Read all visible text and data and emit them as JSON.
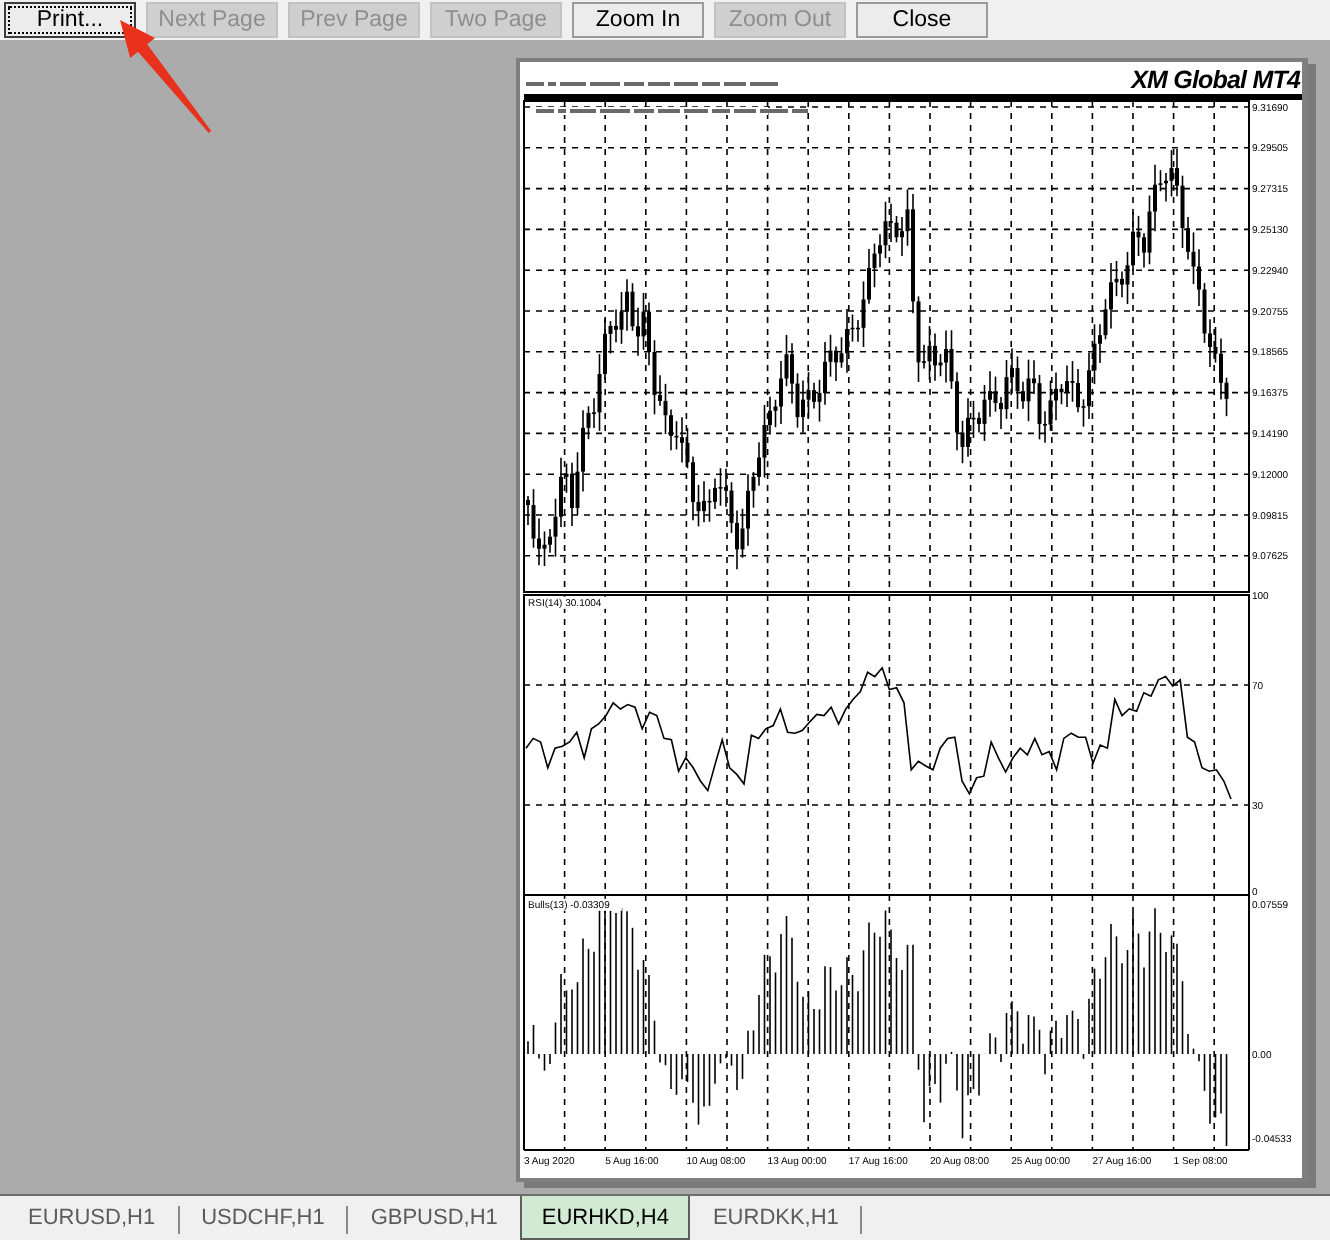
{
  "toolbar": {
    "buttons": [
      {
        "label": "Print...",
        "disabled": false,
        "focused": true
      },
      {
        "label": "Next Page",
        "disabled": true,
        "focused": false
      },
      {
        "label": "Prev Page",
        "disabled": true,
        "focused": false
      },
      {
        "label": "Two Page",
        "disabled": true,
        "focused": false
      },
      {
        "label": "Zoom In",
        "disabled": false,
        "focused": false
      },
      {
        "label": "Zoom Out",
        "disabled": true,
        "focused": false
      },
      {
        "label": "Close",
        "disabled": false,
        "focused": false
      }
    ]
  },
  "print_page": {
    "title": "XM Global MT4",
    "price_axis": [
      "9.31690",
      "9.29505",
      "9.27315",
      "9.25130",
      "9.22940",
      "9.20755",
      "9.18565",
      "9.16375",
      "9.14190",
      "9.12000",
      "9.09815",
      "9.07625"
    ],
    "rsi_panel": {
      "chart_data": {
        "type": "line",
        "title": "RSI(14) 30.1004",
        "ylim": [
          0,
          100
        ],
        "yticks": [
          100,
          70,
          30,
          0
        ],
        "grid": true,
        "series": [
          {
            "color": "#000000",
            "values": [
              48.9,
              52.2,
              51,
              42.4,
              48.9,
              49.6,
              51,
              54.3,
              45.7,
              55.4,
              57,
              59.8,
              64.1,
              62,
              63.5,
              62.6,
              55.4,
              60.9,
              59.8,
              52.2,
              51.7,
              41.3,
              45.7,
              42.4,
              38,
              34.8,
              43.5,
              51.7,
              42.4,
              40.2,
              37,
              53.3,
              52.2,
              55.4,
              56.5,
              62,
              54.3,
              53.9,
              54.8,
              57.6,
              60.2,
              59.8,
              62.6,
              57,
              62,
              65.2,
              67.8,
              74.3,
              72.8,
              75.7,
              68.5,
              69.1,
              64.1,
              41.7,
              44.6,
              43,
              41.7,
              48.9,
              52.2,
              52.6,
              38,
              33.7,
              39.1,
              39.6,
              51,
              45.7,
              41,
              45.7,
              48.9,
              46.7,
              52.2,
              46.7,
              47.8,
              41.7,
              52.2,
              53.9,
              52.6,
              52.6,
              43.9,
              50,
              48.9,
              65.2,
              59.8,
              62,
              61.3,
              67.4,
              66.3,
              71.7,
              72.8,
              69.6,
              71.7,
              52.6,
              51,
              42.4,
              41.3,
              41.7,
              38,
              32
            ]
          }
        ]
      }
    },
    "bulls_label": "Bulls(13) -0.03309",
    "bulls_axis": [
      "0.07559",
      "0.00",
      "-0.04533"
    ],
    "time_axis": [
      "3 Aug 2020",
      "5 Aug 16:00",
      "10 Aug 08:00",
      "13 Aug 00:00",
      "17 Aug 16:00",
      "20 Aug 08:00",
      "25 Aug 00:00",
      "27 Aug 16:00",
      "1 Sep 08:00"
    ]
  },
  "tabs": [
    {
      "label": "EURUSD,H1",
      "selected": false
    },
    {
      "label": "USDCHF,H1",
      "selected": false
    },
    {
      "label": "GBPUSD,H1",
      "selected": false
    },
    {
      "label": "EURHKD,H4",
      "selected": true
    },
    {
      "label": "EURDKK,H1",
      "selected": false
    }
  ]
}
